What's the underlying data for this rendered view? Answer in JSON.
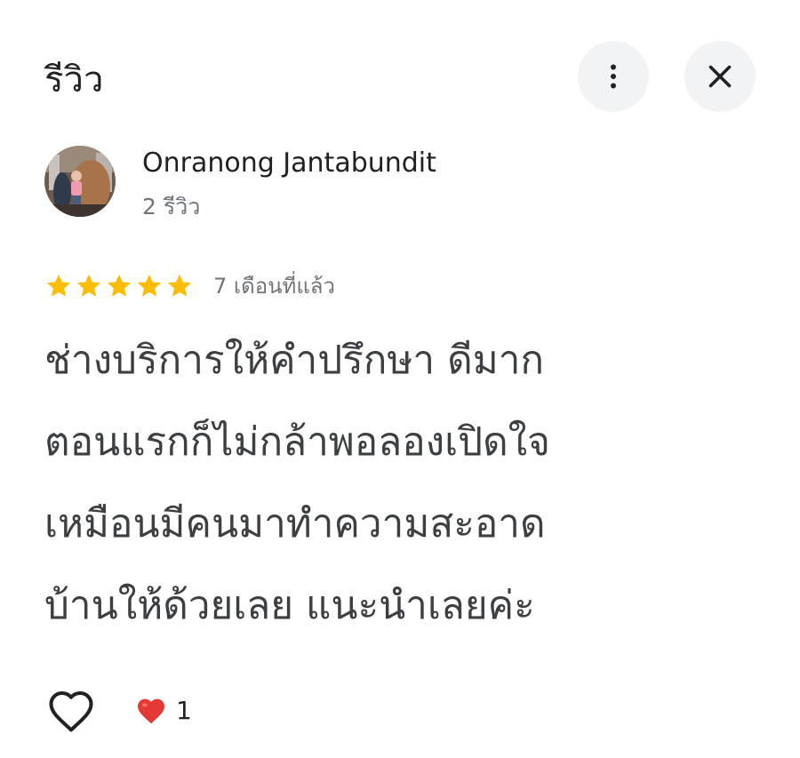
{
  "header": {
    "title": "รีวิว",
    "more_icon": "more-vert-icon",
    "close_icon": "close-icon"
  },
  "author": {
    "name": "Onranong Jantabundit",
    "reviews": "2 รีวิว"
  },
  "review": {
    "rating": 5,
    "max_rating": 5,
    "date": "7 เดือนที่แล้ว",
    "text": "ช่างบริการให้คำปรึกษา ดีมาก\nตอนแรกก็ไม่กล้าพอลองเปิดใจ\nเหมือนมีคนมาทำความสะอาด\nบ้านให้ด้วยเลย  แนะนำเลยค่ะ"
  },
  "reactions": {
    "like_icon": "heart-outline-icon",
    "reaction_icon": "red-heart-icon",
    "count": "1"
  },
  "colors": {
    "star": "#fbbc04",
    "heart": "#e53935",
    "button_bg": "#f1f3f4",
    "secondary_text": "#70757a"
  }
}
